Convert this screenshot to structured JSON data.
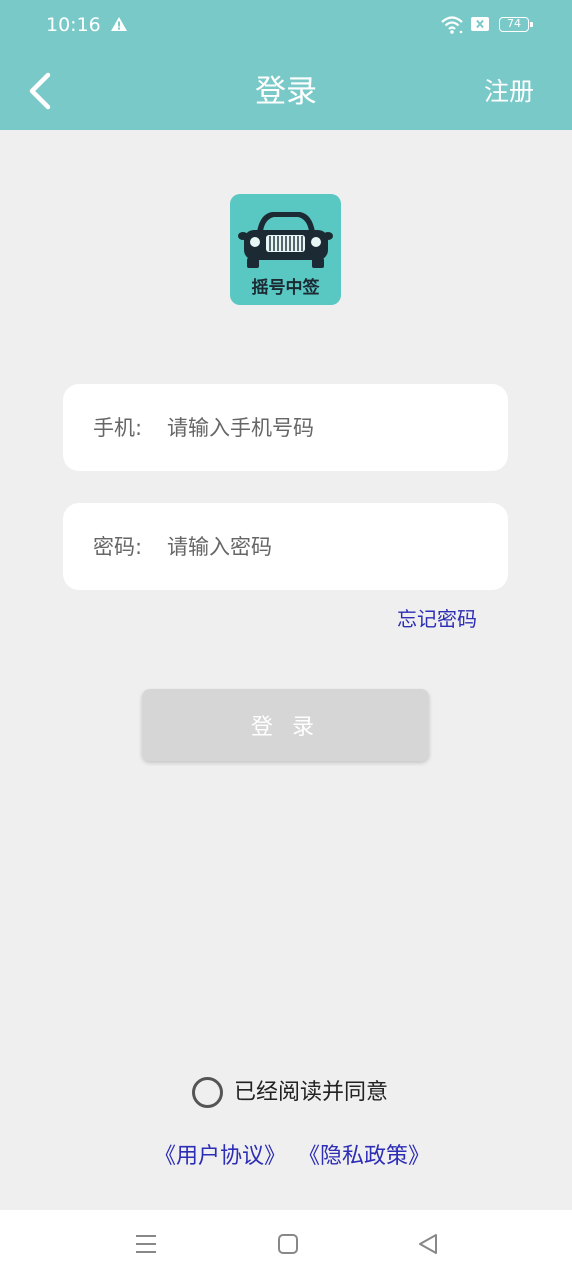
{
  "status_bar": {
    "time": "10:16",
    "battery": "74",
    "icons": [
      "warning-icon",
      "wifi-icon",
      "sim-icon",
      "battery-icon"
    ]
  },
  "header": {
    "title": "登录",
    "right_action": "注册",
    "background": "#7ac9c9"
  },
  "logo": {
    "text": "摇号中签",
    "background": "#59c7c2"
  },
  "form": {
    "phone_label": "手机:",
    "phone_placeholder": "请输入手机号码",
    "phone_value": "",
    "password_label": "密码:",
    "password_placeholder": "请输入密码",
    "password_value": "",
    "forgot_password": "忘记密码",
    "login_button": "登 录"
  },
  "agreement": {
    "checked": false,
    "text": "已经阅读并同意",
    "user_agreement": "《用户协议》",
    "privacy_policy": "《隐私政策》",
    "link_color": "#2d2db6"
  },
  "nav_bar": {
    "icons": [
      "menu-icon",
      "home-icon",
      "back-triangle-icon"
    ]
  }
}
